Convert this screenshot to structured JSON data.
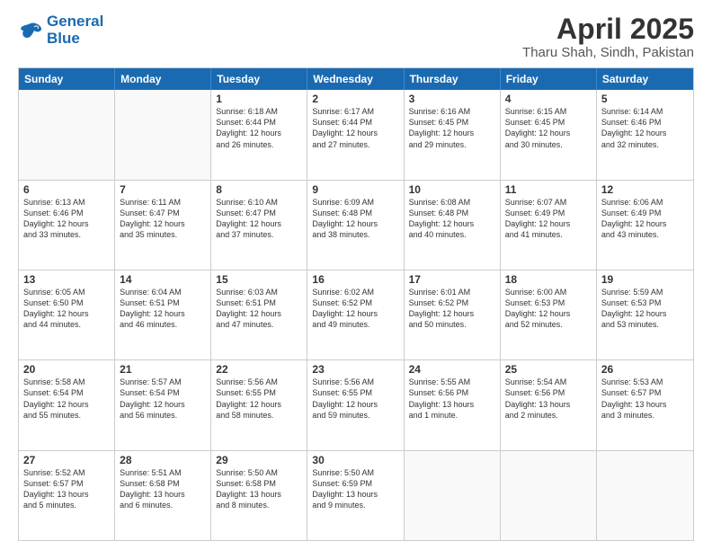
{
  "header": {
    "logo_line1": "General",
    "logo_line2": "Blue",
    "month_title": "April 2025",
    "location": "Tharu Shah, Sindh, Pakistan"
  },
  "weekdays": [
    "Sunday",
    "Monday",
    "Tuesday",
    "Wednesday",
    "Thursday",
    "Friday",
    "Saturday"
  ],
  "rows": [
    [
      {
        "day": "",
        "text": "",
        "empty": true
      },
      {
        "day": "",
        "text": "",
        "empty": true
      },
      {
        "day": "1",
        "text": "Sunrise: 6:18 AM\nSunset: 6:44 PM\nDaylight: 12 hours\nand 26 minutes."
      },
      {
        "day": "2",
        "text": "Sunrise: 6:17 AM\nSunset: 6:44 PM\nDaylight: 12 hours\nand 27 minutes."
      },
      {
        "day": "3",
        "text": "Sunrise: 6:16 AM\nSunset: 6:45 PM\nDaylight: 12 hours\nand 29 minutes."
      },
      {
        "day": "4",
        "text": "Sunrise: 6:15 AM\nSunset: 6:45 PM\nDaylight: 12 hours\nand 30 minutes."
      },
      {
        "day": "5",
        "text": "Sunrise: 6:14 AM\nSunset: 6:46 PM\nDaylight: 12 hours\nand 32 minutes."
      }
    ],
    [
      {
        "day": "6",
        "text": "Sunrise: 6:13 AM\nSunset: 6:46 PM\nDaylight: 12 hours\nand 33 minutes."
      },
      {
        "day": "7",
        "text": "Sunrise: 6:11 AM\nSunset: 6:47 PM\nDaylight: 12 hours\nand 35 minutes."
      },
      {
        "day": "8",
        "text": "Sunrise: 6:10 AM\nSunset: 6:47 PM\nDaylight: 12 hours\nand 37 minutes."
      },
      {
        "day": "9",
        "text": "Sunrise: 6:09 AM\nSunset: 6:48 PM\nDaylight: 12 hours\nand 38 minutes."
      },
      {
        "day": "10",
        "text": "Sunrise: 6:08 AM\nSunset: 6:48 PM\nDaylight: 12 hours\nand 40 minutes."
      },
      {
        "day": "11",
        "text": "Sunrise: 6:07 AM\nSunset: 6:49 PM\nDaylight: 12 hours\nand 41 minutes."
      },
      {
        "day": "12",
        "text": "Sunrise: 6:06 AM\nSunset: 6:49 PM\nDaylight: 12 hours\nand 43 minutes."
      }
    ],
    [
      {
        "day": "13",
        "text": "Sunrise: 6:05 AM\nSunset: 6:50 PM\nDaylight: 12 hours\nand 44 minutes."
      },
      {
        "day": "14",
        "text": "Sunrise: 6:04 AM\nSunset: 6:51 PM\nDaylight: 12 hours\nand 46 minutes."
      },
      {
        "day": "15",
        "text": "Sunrise: 6:03 AM\nSunset: 6:51 PM\nDaylight: 12 hours\nand 47 minutes."
      },
      {
        "day": "16",
        "text": "Sunrise: 6:02 AM\nSunset: 6:52 PM\nDaylight: 12 hours\nand 49 minutes."
      },
      {
        "day": "17",
        "text": "Sunrise: 6:01 AM\nSunset: 6:52 PM\nDaylight: 12 hours\nand 50 minutes."
      },
      {
        "day": "18",
        "text": "Sunrise: 6:00 AM\nSunset: 6:53 PM\nDaylight: 12 hours\nand 52 minutes."
      },
      {
        "day": "19",
        "text": "Sunrise: 5:59 AM\nSunset: 6:53 PM\nDaylight: 12 hours\nand 53 minutes."
      }
    ],
    [
      {
        "day": "20",
        "text": "Sunrise: 5:58 AM\nSunset: 6:54 PM\nDaylight: 12 hours\nand 55 minutes."
      },
      {
        "day": "21",
        "text": "Sunrise: 5:57 AM\nSunset: 6:54 PM\nDaylight: 12 hours\nand 56 minutes."
      },
      {
        "day": "22",
        "text": "Sunrise: 5:56 AM\nSunset: 6:55 PM\nDaylight: 12 hours\nand 58 minutes."
      },
      {
        "day": "23",
        "text": "Sunrise: 5:56 AM\nSunset: 6:55 PM\nDaylight: 12 hours\nand 59 minutes."
      },
      {
        "day": "24",
        "text": "Sunrise: 5:55 AM\nSunset: 6:56 PM\nDaylight: 13 hours\nand 1 minute."
      },
      {
        "day": "25",
        "text": "Sunrise: 5:54 AM\nSunset: 6:56 PM\nDaylight: 13 hours\nand 2 minutes."
      },
      {
        "day": "26",
        "text": "Sunrise: 5:53 AM\nSunset: 6:57 PM\nDaylight: 13 hours\nand 3 minutes."
      }
    ],
    [
      {
        "day": "27",
        "text": "Sunrise: 5:52 AM\nSunset: 6:57 PM\nDaylight: 13 hours\nand 5 minutes."
      },
      {
        "day": "28",
        "text": "Sunrise: 5:51 AM\nSunset: 6:58 PM\nDaylight: 13 hours\nand 6 minutes."
      },
      {
        "day": "29",
        "text": "Sunrise: 5:50 AM\nSunset: 6:58 PM\nDaylight: 13 hours\nand 8 minutes."
      },
      {
        "day": "30",
        "text": "Sunrise: 5:50 AM\nSunset: 6:59 PM\nDaylight: 13 hours\nand 9 minutes."
      },
      {
        "day": "",
        "text": "",
        "empty": true
      },
      {
        "day": "",
        "text": "",
        "empty": true
      },
      {
        "day": "",
        "text": "",
        "empty": true
      }
    ]
  ]
}
